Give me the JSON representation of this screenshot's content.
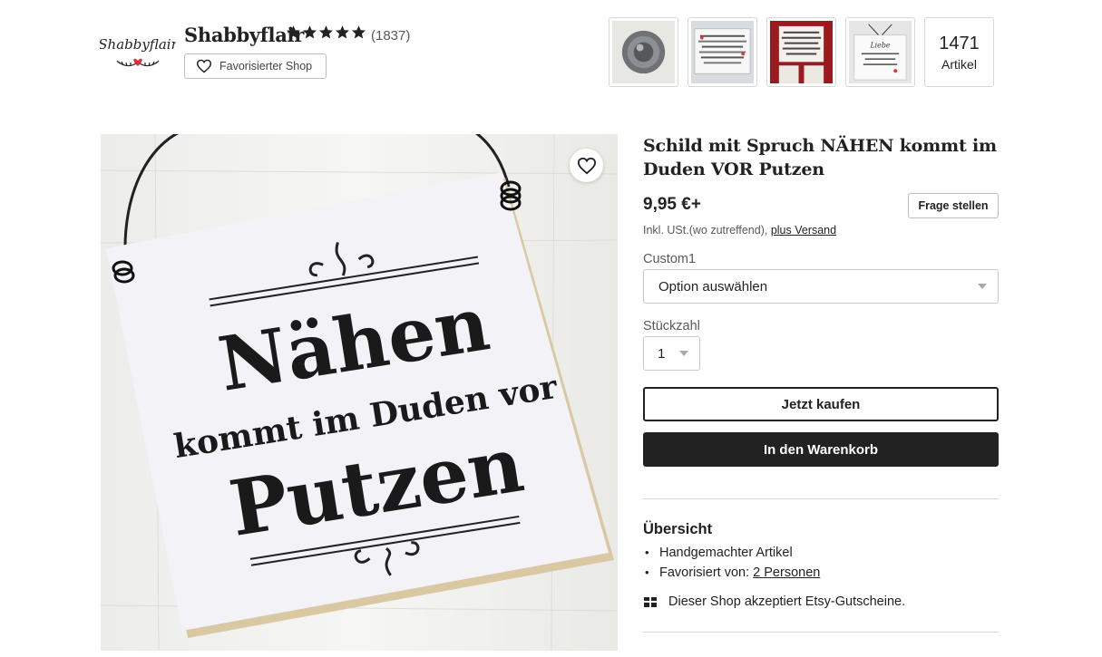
{
  "shop": {
    "logo_text": "Shabbyflair",
    "name": "Shabbyflair",
    "rating": 5,
    "review_count": "(1837)",
    "favorite_label": "Favorisierter Shop",
    "item_count": "1471",
    "item_count_label": "Artikel"
  },
  "listing": {
    "title": "Schild mit Spruch NÄHEN kommt im Duden VOR Putzen",
    "price": "9,95 €+",
    "ask_button": "Frage stellen",
    "tax_note": "Inkl. USt.(wo zutreffend),",
    "shipping_link": "plus Versand",
    "custom_label": "Custom1",
    "custom_select": "Option auswählen",
    "qty_label": "Stückzahl",
    "qty_value": "1",
    "buy_now": "Jetzt kaufen",
    "add_to_cart": "In den Warenkorb"
  },
  "sign": {
    "line1": "Nähen",
    "line2": "kommt im Duden vor",
    "line3": "Putzen"
  },
  "overview": {
    "title": "Übersicht",
    "item1": "Handgemachter Artikel",
    "item2_prefix": "Favorisiert von:",
    "item2_link": "2 Personen",
    "giftcard": "Dieser Shop akzeptiert Etsy-Gutscheine."
  }
}
